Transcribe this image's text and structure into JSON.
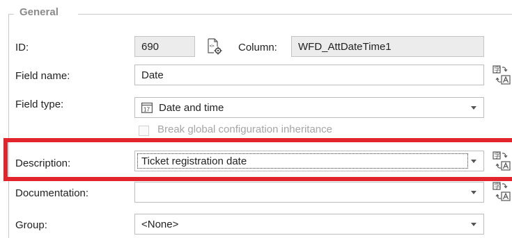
{
  "group": {
    "title": "General"
  },
  "fields": {
    "id": {
      "label": "ID:",
      "value": "690"
    },
    "column": {
      "label": "Column:",
      "value": "WFD_AttDateTime1"
    },
    "field_name": {
      "label": "Field name:",
      "value": "Date"
    },
    "field_type": {
      "label": "Field type:",
      "value": "Date and time",
      "icon_text": "17"
    },
    "break_inheritance": {
      "label": "Break global configuration inheritance",
      "checked": false
    },
    "description": {
      "label": "Description:",
      "value": "Ticket registration date"
    },
    "documentation": {
      "label": "Documentation:",
      "value": ""
    },
    "group_field": {
      "label": "Group:",
      "value": "<None>"
    }
  },
  "icons": {
    "column_icon": "xml-document-gear-icon",
    "translate_icon": "translate-icon"
  },
  "colors": {
    "highlight": "#e2252c",
    "readonly_bg": "#ececec",
    "group_title": "#8a8a8a"
  }
}
